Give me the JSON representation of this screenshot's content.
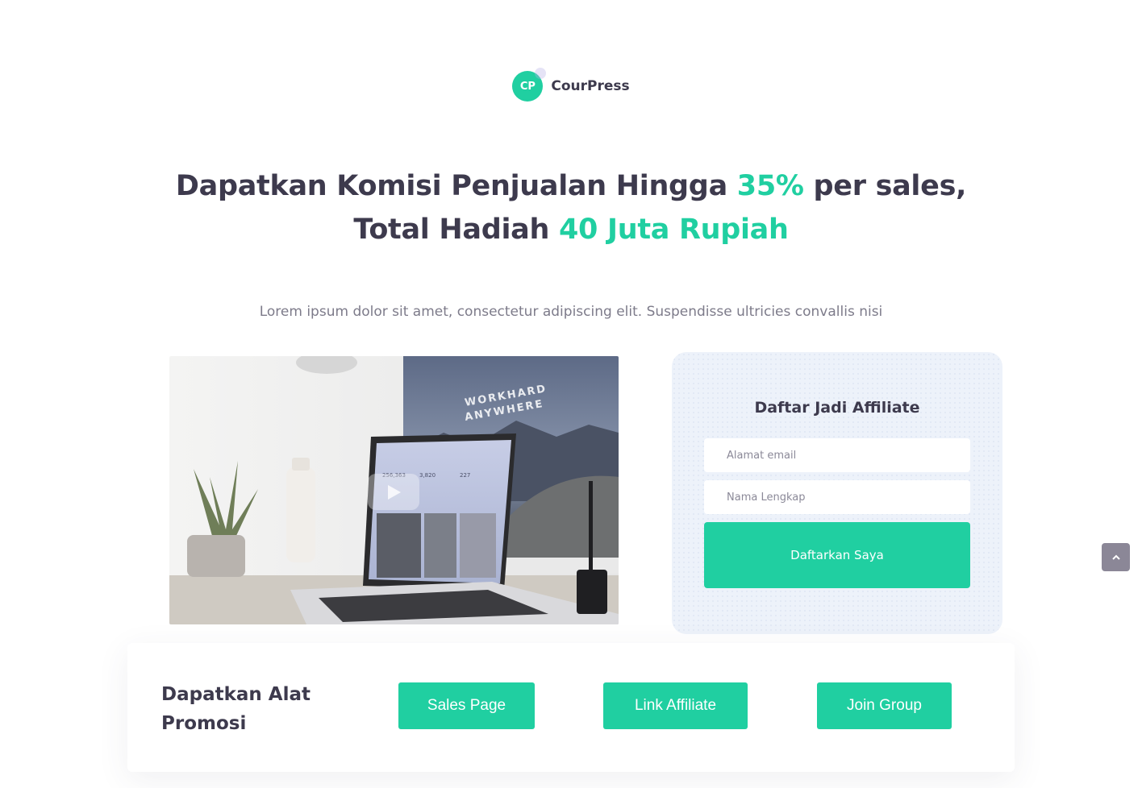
{
  "brand": {
    "initials": "CP",
    "name": "CourPress"
  },
  "headline": {
    "line1_prefix": "Dapatkan Komisi Penjualan Hingga ",
    "line1_accent": "35%",
    "line1_suffix": " per sales,",
    "line2_prefix": "Total Hadiah ",
    "line2_accent": "40 Juta Rupiah"
  },
  "subtitle": "Lorem ipsum dolor sit amet, consectetur adipiscing elit. Suspendisse ultricies convallis nisi",
  "hero": {
    "poster_line1": "WORKHARD",
    "poster_line2": "ANYWHERE",
    "stats": [
      "256,363",
      "3,820",
      "227"
    ]
  },
  "form": {
    "title": "Daftar Jadi Affiliate",
    "email_placeholder": "Alamat email",
    "name_placeholder": "Nama Lengkap",
    "submit_label": "Daftarkan Saya"
  },
  "promo": {
    "title": "Dapatkan Alat Promosi",
    "buttons": [
      {
        "label": "Sales Page"
      },
      {
        "label": "Link Affiliate"
      },
      {
        "label": "Join Group"
      }
    ]
  },
  "colors": {
    "accent": "#20cfa1",
    "text": "#3d3a4d",
    "muted": "#7d7b8a",
    "card_bg": "#edf2fa",
    "scroll_button": "#8b8797"
  },
  "icons": {
    "play": "play-icon",
    "scroll_top": "chevron-up-icon"
  }
}
